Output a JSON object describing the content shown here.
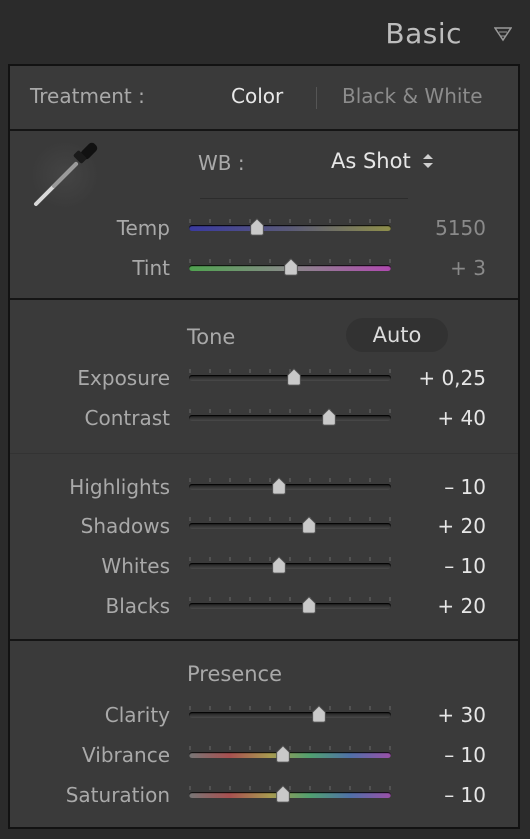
{
  "header": {
    "title": "Basic"
  },
  "treatment": {
    "label": "Treatment :",
    "color": "Color",
    "bw": "Black & White"
  },
  "wb": {
    "label": "WB :",
    "value": "As Shot"
  },
  "tone": {
    "title": "Tone",
    "auto": "Auto"
  },
  "presence": {
    "title": "Presence"
  },
  "sliders": [
    {
      "id": "temp",
      "label": "Temp",
      "value": "5150",
      "position": 0.34,
      "track": "temp",
      "dim": true
    },
    {
      "id": "tint",
      "label": "Tint",
      "value": "+ 3",
      "position": 0.51,
      "track": "tint",
      "dim": true
    },
    {
      "id": "exposure",
      "label": "Exposure",
      "value": "+ 0,25",
      "position": 0.525,
      "track": "gray"
    },
    {
      "id": "contrast",
      "label": "Contrast",
      "value": "+ 40",
      "position": 0.7,
      "track": "gray"
    },
    {
      "id": "highlights",
      "label": "Highlights",
      "value": "– 10",
      "position": 0.45,
      "track": "gray"
    },
    {
      "id": "shadows",
      "label": "Shadows",
      "value": "+ 20",
      "position": 0.6,
      "track": "gray"
    },
    {
      "id": "whites",
      "label": "Whites",
      "value": "– 10",
      "position": 0.45,
      "track": "gray"
    },
    {
      "id": "blacks",
      "label": "Blacks",
      "value": "+ 20",
      "position": 0.6,
      "track": "gray"
    },
    {
      "id": "clarity",
      "label": "Clarity",
      "value": "+ 30",
      "position": 0.65,
      "track": "gray"
    },
    {
      "id": "vibrance",
      "label": "Vibrance",
      "value": "– 10",
      "position": 0.47,
      "track": "vibrance"
    },
    {
      "id": "saturation",
      "label": "Saturation",
      "value": "– 10",
      "position": 0.47,
      "track": "saturation"
    }
  ],
  "icons": {
    "eyedropper": "eyedropper-icon",
    "panel_toggle": "triangle-down-icon",
    "updown": "updown-arrows-icon"
  },
  "colors": {
    "background": "#2b2b2b",
    "panel": "#3a3a3a",
    "text_bright": "#e6e6e6",
    "text_label": "#a9a9a9"
  }
}
